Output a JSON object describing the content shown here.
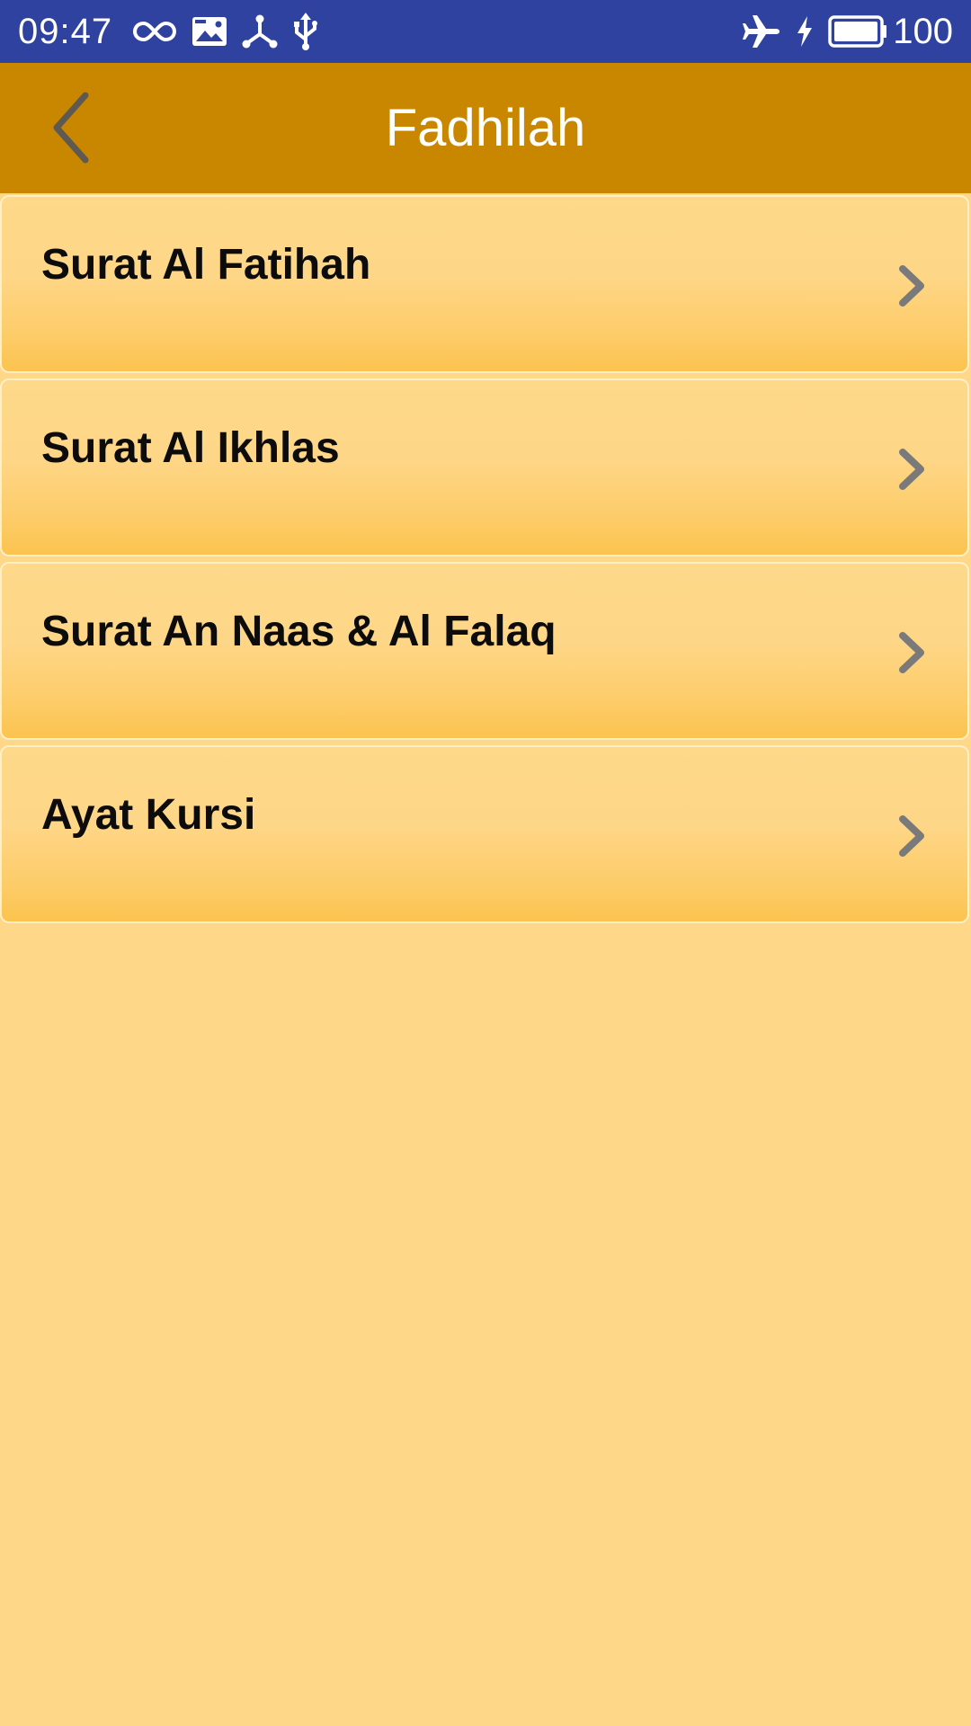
{
  "status_bar": {
    "time": "09:47",
    "battery": "100",
    "left_icons": [
      "infinity-icon",
      "image-icon",
      "share-node-icon",
      "usb-icon"
    ],
    "right_icons": [
      "airplane-icon",
      "charging-icon",
      "battery-icon"
    ]
  },
  "header": {
    "title": "Fadhilah",
    "back_icon": "chevron-left-icon"
  },
  "list": {
    "items": [
      {
        "label": "Surat Al Fatihah"
      },
      {
        "label": "Surat Al Ikhlas"
      },
      {
        "label": "Surat An Naas & Al Falaq"
      },
      {
        "label": "Ayat Kursi"
      }
    ]
  },
  "colors": {
    "status_bar": "#2f42a0",
    "app_bar": "#c98700",
    "background": "#fed788",
    "chevron": "#7a7a7a"
  }
}
